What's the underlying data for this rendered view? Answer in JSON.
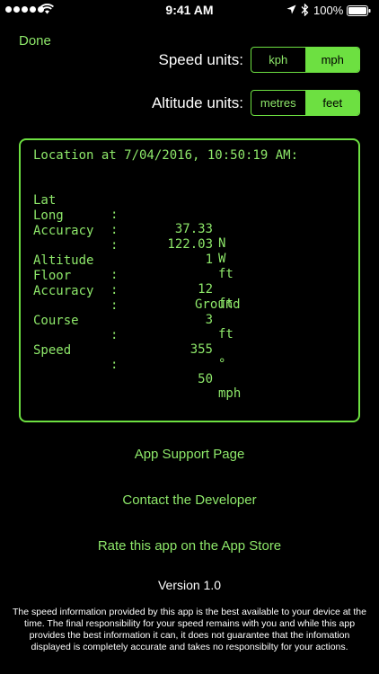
{
  "status_bar": {
    "time": "9:41 AM",
    "battery_percent": "100%",
    "icons": [
      "signal-dots",
      "wifi-icon",
      "location-arrow-icon",
      "bluetooth-icon",
      "battery-icon"
    ]
  },
  "header": {
    "done_label": "Done",
    "speed_units": {
      "label": "Speed units:",
      "options": [
        "kph",
        "mph"
      ],
      "selected": "mph"
    },
    "altitude_units": {
      "label": "Altitude units:",
      "options": [
        "metres",
        "feet"
      ],
      "selected": "feet"
    }
  },
  "readout": {
    "title": "Location at 7/04/2016, 10:50:19 AM:",
    "colon": ":",
    "lat": {
      "label": "Lat",
      "value": "37.33",
      "unit": "N"
    },
    "long": {
      "label": "Long",
      "value": "122.03",
      "unit": "W"
    },
    "accuracy_h": {
      "label": "Accuracy",
      "value": "1",
      "unit": "ft"
    },
    "altitude": {
      "label": "Altitude",
      "value": "12",
      "unit": "ft"
    },
    "floor": {
      "label": "Floor",
      "value": "Ground"
    },
    "accuracy_v": {
      "label": "Accuracy",
      "value": "3",
      "unit": "ft"
    },
    "course": {
      "label": "Course",
      "value": "355",
      "unit": "°"
    },
    "speed": {
      "label": "Speed",
      "value": "50",
      "unit": "mph"
    }
  },
  "links": {
    "support": "App Support Page",
    "contact": "Contact the Developer",
    "rate": "Rate this app on the App Store"
  },
  "version": "Version 1.0",
  "disclaimer": "The speed information provided by this app is the best available to your device at the time. The final responsibility for your speed remains with you and while this app provides the best information it can, it does not guarantee that the infomation displayed is completely accurate and takes no responsibilty for your actions.",
  "colors": {
    "accent": "#6de041",
    "accent_text": "#8ee86a",
    "background": "#000000"
  }
}
